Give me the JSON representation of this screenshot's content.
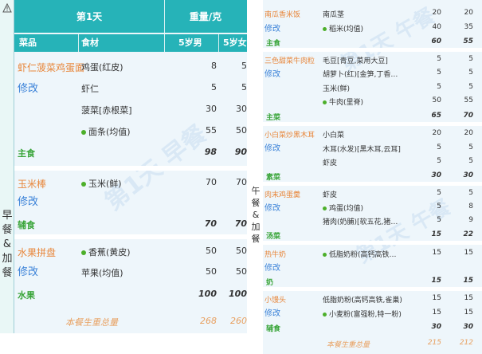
{
  "left": {
    "side_label": "早餐&加餐",
    "header": {
      "day": "第1天",
      "weight": "重量/克",
      "col_dish": "菜品",
      "col_ing": "食材",
      "col_m": "5岁男",
      "col_f": "5岁女"
    },
    "watermark": "第1天 早餐",
    "rows": [
      {
        "dish": "虾仁菠菜鸡蛋面",
        "edit": "修改",
        "ing": "鸡蛋(红皮)",
        "dot": false,
        "m": "8",
        "f": "5"
      },
      {
        "ing": "虾仁",
        "dot": false,
        "m": "5",
        "f": "5"
      },
      {
        "ing": "菠菜[赤根菜]",
        "dot": false,
        "m": "30",
        "f": "30"
      },
      {
        "ing": "面条(均值)",
        "dot": true,
        "m": "55",
        "f": "50"
      },
      {
        "sub": "主食",
        "m": "98",
        "f": "90"
      },
      {
        "dish": "玉米棒",
        "edit": "修改",
        "ing": "玉米(鲜)",
        "dot": true,
        "m": "70",
        "f": "70"
      },
      {
        "sub": "辅食",
        "m": "70",
        "f": "70"
      },
      {
        "dish": "水果拼盘",
        "edit": "修改",
        "ing": "香蕉(黄皮)",
        "dot": true,
        "m": "50",
        "f": "50"
      },
      {
        "ing": "苹果(均值)",
        "dot": false,
        "m": "50",
        "f": "50"
      },
      {
        "sub": "水果",
        "m": "100",
        "f": "100"
      }
    ],
    "footer": {
      "label": "本餐生重总量",
      "m": "268",
      "f": "260"
    }
  },
  "right": {
    "side_label": "午餐&加餐",
    "watermark": "第1天 午餐",
    "rows": [
      {
        "dish": "南瓜香米饭",
        "ing": "南瓜茎",
        "dot": false,
        "m": "20",
        "f": "20"
      },
      {
        "edit": "修改",
        "ing": "稻米(均值)",
        "dot": true,
        "m": "40",
        "f": "35"
      },
      {
        "sub": "主食",
        "m": "60",
        "f": "55"
      },
      {
        "dish": "三色甜菜牛肉粒",
        "ing": "毛豆[青豆,菜用大豆]",
        "dot": false,
        "m": "5",
        "f": "5"
      },
      {
        "edit": "修改",
        "ing": "胡萝卜(红)[金笋,丁香…",
        "dot": false,
        "m": "5",
        "f": "5"
      },
      {
        "ing": "玉米(鲜)",
        "dot": false,
        "m": "5",
        "f": "5"
      },
      {
        "ing": "牛肉(里脊)",
        "dot": true,
        "m": "50",
        "f": "55"
      },
      {
        "sub": "主菜",
        "m": "65",
        "f": "70"
      },
      {
        "dish": "小白菜炒黑木耳",
        "ing": "小白菜",
        "dot": false,
        "m": "20",
        "f": "20"
      },
      {
        "edit": "修改",
        "ing": "木耳(水发)[黑木耳,云耳]",
        "dot": false,
        "m": "5",
        "f": "5"
      },
      {
        "ing": "虾皮",
        "dot": false,
        "m": "5",
        "f": "5"
      },
      {
        "sub": "素菜",
        "m": "30",
        "f": "30"
      },
      {
        "dish": "肉末鸡蛋羹",
        "ing": "虾皮",
        "dot": false,
        "m": "5",
        "f": "5"
      },
      {
        "edit": "修改",
        "ing": "鸡蛋(均值)",
        "dot": true,
        "m": "5",
        "f": "8"
      },
      {
        "ing": "猪肉(奶脯)[软五花,猪…",
        "dot": false,
        "m": "5",
        "f": "9"
      },
      {
        "sub": "汤菜",
        "m": "15",
        "f": "22"
      },
      {
        "dish": "热牛奶",
        "ing": "低脂奶粉(高钙高铁…",
        "dot": true,
        "m": "15",
        "f": "15"
      },
      {
        "edit": "修改"
      },
      {
        "sub": "奶",
        "m": "15",
        "f": "15"
      },
      {
        "dish": "小馒头",
        "ing": "低脂奶粉(高钙高铁,雀巢)",
        "dot": false,
        "m": "15",
        "f": "15"
      },
      {
        "edit": "修改",
        "ing": "小麦粉(富强粉,特一粉)",
        "dot": true,
        "m": "15",
        "f": "15"
      },
      {
        "sub": "辅食",
        "m": "30",
        "f": "30"
      }
    ],
    "footer": {
      "label": "本餐生重总量",
      "m": "215",
      "f": "212"
    }
  }
}
